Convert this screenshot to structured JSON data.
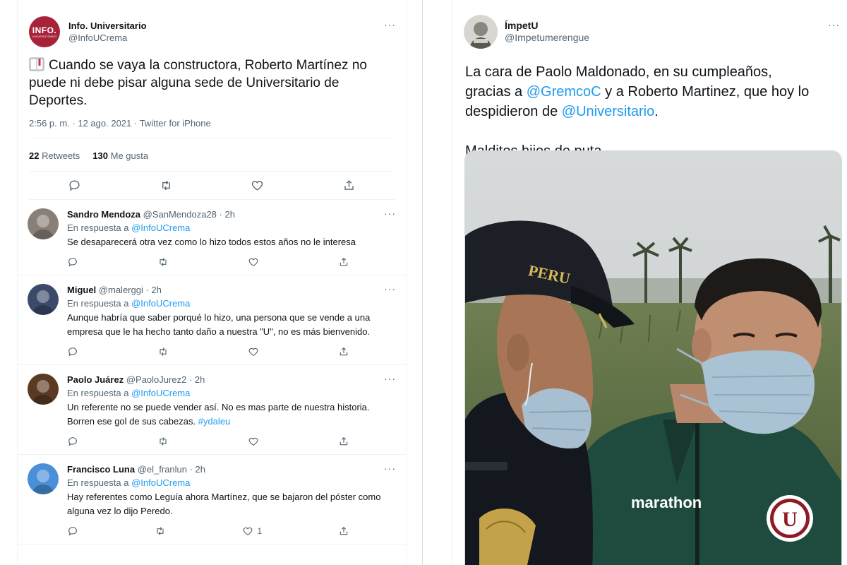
{
  "main_tweet": {
    "author": "Info. Universitario",
    "handle": "@InfoUCrema",
    "avatar_text": "INFO.",
    "avatar_subtext": "UNIVERSITARIO",
    "text": "Cuando se vaya la constructora, Roberto Martínez no puede ni debe pisar alguna sede de Universitario de Deportes.",
    "timestamp": "2:56 p. m. · 12 ago. 2021 · Twitter for iPhone",
    "retweets_count": "22",
    "retweets_label": "Retweets",
    "likes_count": "130",
    "likes_label": "Me gusta",
    "more": "···"
  },
  "replies": [
    {
      "name": "Sandro Mendoza",
      "handle": "@SanMendoza28 · 2h",
      "reply_prefix": "En respuesta a",
      "reply_to": "@InfoUCrema",
      "text": "Se desaparecerá otra vez como lo hizo todos estos años no le interesa",
      "likes": "",
      "avatar_color": "#8a7f76"
    },
    {
      "name": "Miguel",
      "handle": "@malerggi · 2h",
      "reply_prefix": "En respuesta a",
      "reply_to": "@InfoUCrema",
      "text": "Aunque habría que saber porqué lo hizo, una persona que se vende a una empresa que le ha hecho tanto daño a nuestra \"U\", no es más bienvenido.",
      "likes": "",
      "avatar_color": "#3a4a68"
    },
    {
      "name": "Paolo Juárez",
      "handle": "@PaoloJurez2 · 2h",
      "reply_prefix": "En respuesta a",
      "reply_to": "@InfoUCrema",
      "text": "Un referente no se puede vender así. No es mas parte de nuestra historia. Borren ese gol de sus cabezas.",
      "hashtag": "#ydaleu",
      "likes": "",
      "avatar_color": "#5a3a22"
    },
    {
      "name": "Francisco Luna",
      "handle": "@el_franlun · 2h",
      "reply_prefix": "En respuesta a",
      "reply_to": "@InfoUCrema",
      "text": "Hay referentes como Leguía ahora Martínez, que se bajaron del póster como alguna vez lo dijo Peredo.",
      "likes": "1",
      "avatar_color": "#4a90d9"
    }
  ],
  "right_tweet": {
    "author": "ÍmpetU",
    "handle": "@Impetumerengue",
    "line1": "La cara de Paolo Maldonado, en su cumpleaños,",
    "line2_pre": "gracias a ",
    "mention1": "@GremcoC",
    "line2_post": " y a Roberto Martinez, que hoy lo",
    "line3_pre": "despidieron de ",
    "mention2": "@Universitario",
    "line3_post": ".",
    "line4": "Malditos hijos de puta.",
    "photo_cap_text": "PERU",
    "photo_shirt_text": "marathon",
    "photo_badge": "U",
    "more": "···"
  },
  "colors": {
    "accent": "#1d9bf0",
    "text": "#0f1419",
    "muted": "#536471",
    "brand_info": "#a8233a"
  }
}
